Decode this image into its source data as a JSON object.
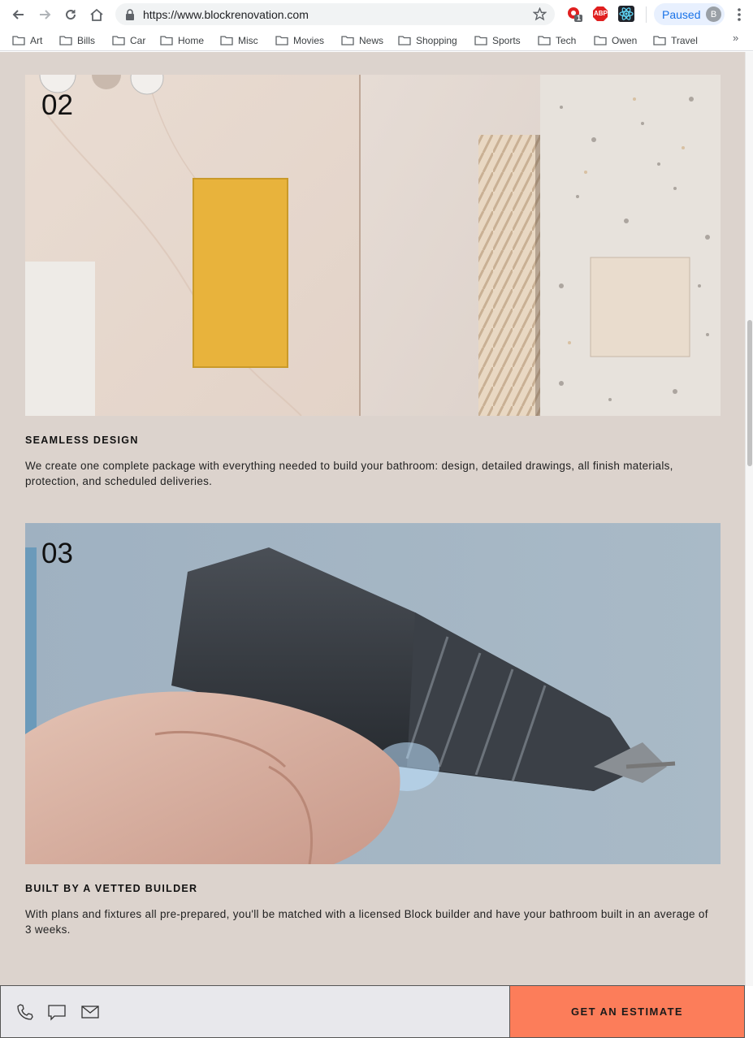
{
  "browser": {
    "url": "https://www.blockrenovation.com",
    "profile_status": "Paused",
    "profile_initial": "B",
    "extension_badge": "1",
    "abp_label": "ABP",
    "overflow_chevron": "»"
  },
  "bookmarks": [
    "Art",
    "Bills",
    "Car",
    "Home",
    "Misc",
    "Movies",
    "News",
    "Shopping",
    "Sports",
    "Tech",
    "Owen",
    "Travel"
  ],
  "steps": [
    {
      "number": "02",
      "title": "SEAMLESS DESIGN",
      "body": "We create one complete package with everything needed to build your bathroom: design, detailed drawings, all finish materials, protection, and scheduled deliveries."
    },
    {
      "number": "03",
      "title": "BUILT BY A VETTED BUILDER",
      "body": "With plans and fixtures all pre-prepared, you'll be matched with a licensed Block builder and have your bathroom built in an average of 3 weeks."
    }
  ],
  "contact_bar": {
    "cta_label": "GET AN ESTIMATE",
    "icons": [
      "phone-icon",
      "chat-icon",
      "mail-icon"
    ]
  },
  "colors": {
    "page_background": "#dcd3cd",
    "cta_background": "#fc7d5a",
    "contact_bar_background": "#e8e8ec"
  }
}
